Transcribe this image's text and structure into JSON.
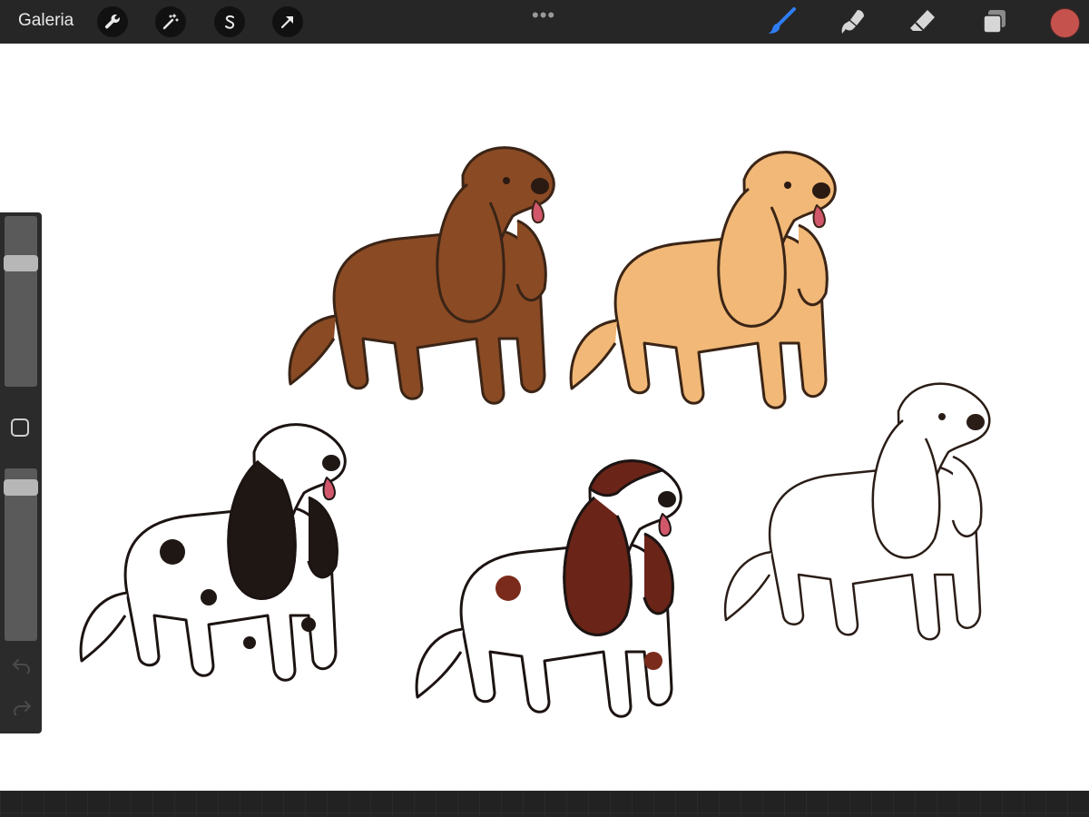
{
  "app": {
    "gallery_label": "Galeria"
  },
  "toolbar_left": [
    {
      "icon": "wrench-icon"
    },
    {
      "icon": "magic-wand-icon"
    },
    {
      "icon": "selection-s-icon"
    },
    {
      "icon": "transform-arrow-icon"
    }
  ],
  "toolbar_right": [
    {
      "icon": "brush-icon",
      "active": true,
      "color": "#2f7df6"
    },
    {
      "icon": "smudge-icon"
    },
    {
      "icon": "eraser-icon"
    },
    {
      "icon": "layers-icon"
    }
  ],
  "colors": {
    "current": "#c5524d",
    "active_tool": "#2f7df6"
  },
  "sidebar": {
    "brush_size_level": 0.75,
    "opacity_level": 0.93,
    "icons": [
      "square-modify-icon",
      "undo-icon",
      "redo-icon"
    ]
  },
  "canvas": {
    "artwork": [
      {
        "subject": "brown-spaniel"
      },
      {
        "subject": "golden-spaniel"
      },
      {
        "subject": "black-white-spaniel"
      },
      {
        "subject": "liver-white-spaniel"
      },
      {
        "subject": "white-outline-spaniel"
      }
    ]
  }
}
